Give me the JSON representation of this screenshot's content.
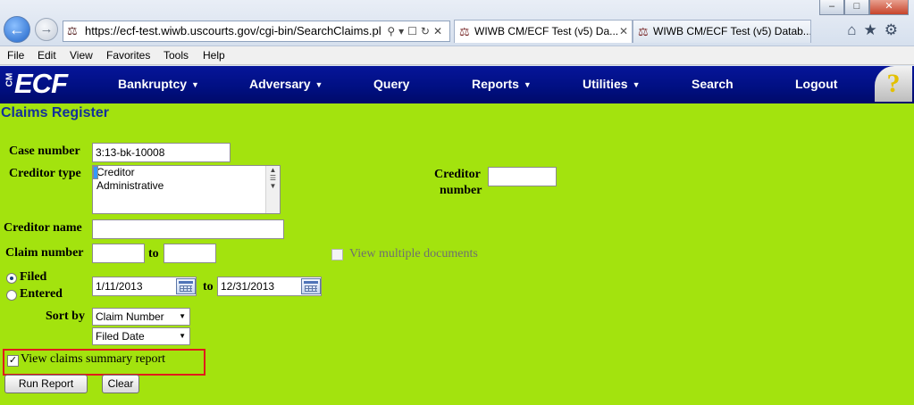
{
  "browser": {
    "url": "https://ecf-test.wiwb.uscourts.gov/cgi-bin/SearchClaims.pl",
    "tabs": [
      {
        "label": "WIWB CM/ECF Test (v5) Da..."
      },
      {
        "label": "WIWB CM/ECF Test (v5) Datab..."
      }
    ],
    "menu": [
      "File",
      "Edit",
      "View",
      "Favorites",
      "Tools",
      "Help"
    ],
    "window_controls": [
      "–",
      "□",
      "✕"
    ]
  },
  "ecf": {
    "logo_cm": "CM",
    "logo_ecf": "ECF",
    "nav": [
      {
        "label": "Bankruptcy",
        "caret": "▼"
      },
      {
        "label": "Adversary",
        "caret": "▼"
      },
      {
        "label": "Query"
      },
      {
        "label": "Reports",
        "caret": "▼"
      },
      {
        "label": "Utilities",
        "caret": "▼"
      },
      {
        "label": "Search"
      },
      {
        "label": "Logout"
      }
    ],
    "help_glyph": "?"
  },
  "page": {
    "title": "Claims Register",
    "case_number": {
      "label": "Case number",
      "value": "3:13-bk-10008"
    },
    "creditor_type": {
      "label": "Creditor type",
      "options": [
        "",
        "Creditor",
        "Administrative"
      ]
    },
    "creditor_number": {
      "label_line1": "Creditor",
      "label_line2": "number",
      "value": ""
    },
    "creditor_name": {
      "label": "Creditor name",
      "value": ""
    },
    "claim_number": {
      "label": "Claim number",
      "from": "",
      "to_label": "to",
      "to": ""
    },
    "view_multiple": {
      "label": "View multiple documents",
      "checked": false,
      "disabled": true
    },
    "date_filter": {
      "filed_label": "Filed",
      "entered_label": "Entered",
      "selected": "Filed",
      "from": "1/11/2013",
      "to_label": "to",
      "to": "12/31/2013"
    },
    "sort_by": {
      "label": "Sort by",
      "primary": "Claim Number",
      "secondary": "Filed Date"
    },
    "summary_report": {
      "label": "View claims summary report",
      "checked": true
    },
    "buttons": {
      "run": "Run Report",
      "clear": "Clear"
    }
  },
  "colors": {
    "page_bg": "#a3e30e",
    "nav_bg": "#000f80",
    "title_color": "#13319a",
    "highlight_border": "#e01b1b"
  }
}
